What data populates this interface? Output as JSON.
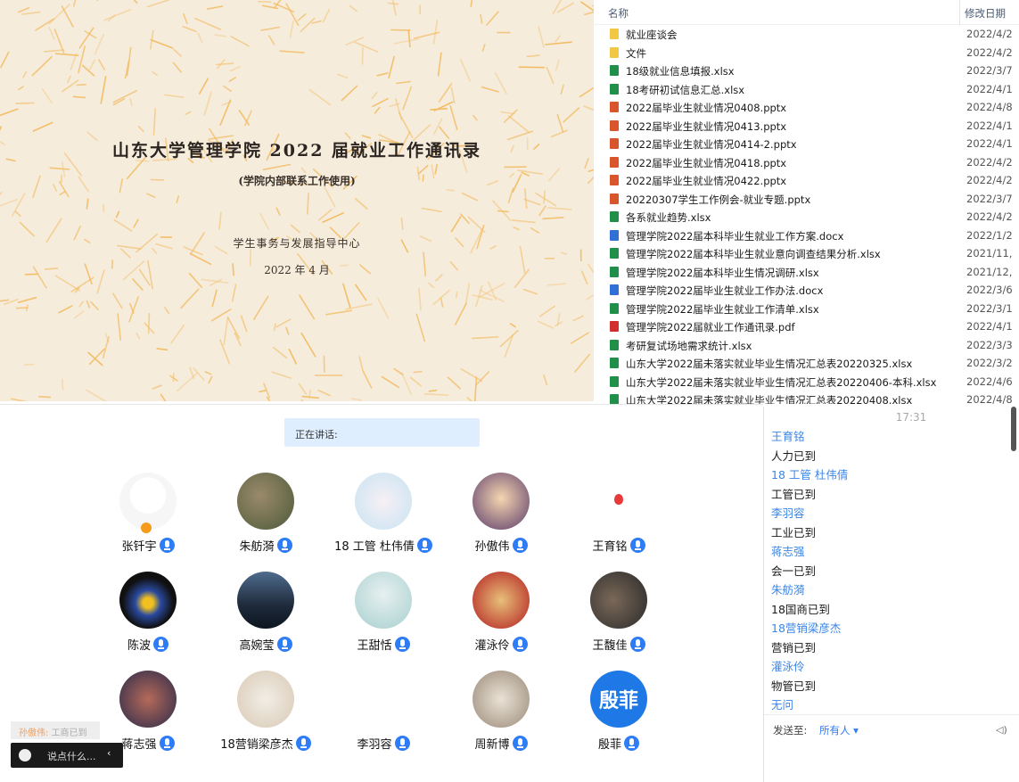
{
  "cover": {
    "title": "山东大学管理学院 2022 届就业工作通讯录",
    "subtitle": "(学院内部联系工作使用)",
    "org": "学生事务与发展指导中心",
    "date": "2022 年 4 月"
  },
  "explorer": {
    "col_name": "名称",
    "col_date": "修改日期",
    "files": [
      {
        "name": "就业座谈会",
        "date": "2022/4/2",
        "type": "folder"
      },
      {
        "name": "文件",
        "date": "2022/4/2",
        "type": "folder"
      },
      {
        "name": "18级就业信息填报.xlsx",
        "date": "2022/3/7",
        "type": "xlsx"
      },
      {
        "name": "18考研初试信息汇总.xlsx",
        "date": "2022/4/1",
        "type": "xlsx"
      },
      {
        "name": "2022届毕业生就业情况0408.pptx",
        "date": "2022/4/8",
        "type": "pptx"
      },
      {
        "name": "2022届毕业生就业情况0413.pptx",
        "date": "2022/4/1",
        "type": "pptx"
      },
      {
        "name": "2022届毕业生就业情况0414-2.pptx",
        "date": "2022/4/1",
        "type": "pptx"
      },
      {
        "name": "2022届毕业生就业情况0418.pptx",
        "date": "2022/4/2",
        "type": "pptx"
      },
      {
        "name": "2022届毕业生就业情况0422.pptx",
        "date": "2022/4/2",
        "type": "pptx"
      },
      {
        "name": "20220307学生工作例会-就业专题.pptx",
        "date": "2022/3/7",
        "type": "pptx"
      },
      {
        "name": "各系就业趋势.xlsx",
        "date": "2022/4/2",
        "type": "xlsx"
      },
      {
        "name": "管理学院2022届本科毕业生就业工作方案.docx",
        "date": "2022/1/2",
        "type": "docx"
      },
      {
        "name": "管理学院2022届本科毕业生就业意向调查结果分析.xlsx",
        "date": "2021/11,",
        "type": "xlsx"
      },
      {
        "name": "管理学院2022届本科毕业生情况调研.xlsx",
        "date": "2021/12,",
        "type": "xlsx"
      },
      {
        "name": "管理学院2022届毕业生就业工作办法.docx",
        "date": "2022/3/6",
        "type": "docx"
      },
      {
        "name": "管理学院2022届毕业生就业工作清单.xlsx",
        "date": "2022/3/1",
        "type": "xlsx"
      },
      {
        "name": "管理学院2022届就业工作通讯录.pdf",
        "date": "2022/4/1",
        "type": "pdf"
      },
      {
        "name": "考研复试场地需求统计.xlsx",
        "date": "2022/3/3",
        "type": "xlsx"
      },
      {
        "name": "山东大学2022届未落实就业毕业生情况汇总表20220325.xlsx",
        "date": "2022/3/2",
        "type": "xlsx"
      },
      {
        "name": "山东大学2022届未落实就业毕业生情况汇总表20220406-本科.xlsx",
        "date": "2022/4/6",
        "type": "xlsx"
      },
      {
        "name": "山东大学2022届未落实就业毕业生情况汇总表20220408.xlsx",
        "date": "2022/4/8",
        "type": "xlsx"
      }
    ]
  },
  "meeting": {
    "speaking_label": "正在讲话:",
    "participants": [
      {
        "name": "张钎宇"
      },
      {
        "name": "朱舫漪"
      },
      {
        "name": "18 工管 杜伟倩"
      },
      {
        "name": "孙傲伟"
      },
      {
        "name": "王育铭"
      },
      {
        "name": "陈波"
      },
      {
        "name": "高婉莹"
      },
      {
        "name": "王甜恬"
      },
      {
        "name": "灌泳伶"
      },
      {
        "name": "王馥佳"
      },
      {
        "name": "蒋志强"
      },
      {
        "name": "18营销梁彦杰"
      },
      {
        "name": "李羽容"
      },
      {
        "name": "周新博"
      },
      {
        "name": "殷菲"
      }
    ],
    "yin_fei_avatar_text": "殷菲",
    "toast_who": "孙傲伟:",
    "toast_msg": "工商已到",
    "chat_placeholder": "说点什么...",
    "chat_chevron": "‹"
  },
  "chat": {
    "time": "17:31",
    "messages": [
      {
        "kind": "sender",
        "text": "王育铭"
      },
      {
        "kind": "text",
        "text": "人力已到"
      },
      {
        "kind": "sender",
        "text": "18 工管 杜伟倩"
      },
      {
        "kind": "text",
        "text": "工管已到"
      },
      {
        "kind": "sender",
        "text": "李羽容"
      },
      {
        "kind": "text",
        "text": "工业已到"
      },
      {
        "kind": "sender",
        "text": "蒋志强"
      },
      {
        "kind": "text",
        "text": "会一已到"
      },
      {
        "kind": "sender",
        "text": "朱舫漪"
      },
      {
        "kind": "text",
        "text": "18国商已到"
      },
      {
        "kind": "sender",
        "text": "18营销梁彦杰"
      },
      {
        "kind": "text",
        "text": "营销已到"
      },
      {
        "kind": "sender",
        "text": "灌泳伶"
      },
      {
        "kind": "text",
        "text": "物管已到"
      },
      {
        "kind": "sender",
        "text": "无问"
      }
    ],
    "send_to_label": "发送至:",
    "send_to_value": "所有人 ▾"
  },
  "colors": {
    "accent": "#2f7df6",
    "sender": "#3a86e8",
    "highlight": "#dfeefe"
  }
}
